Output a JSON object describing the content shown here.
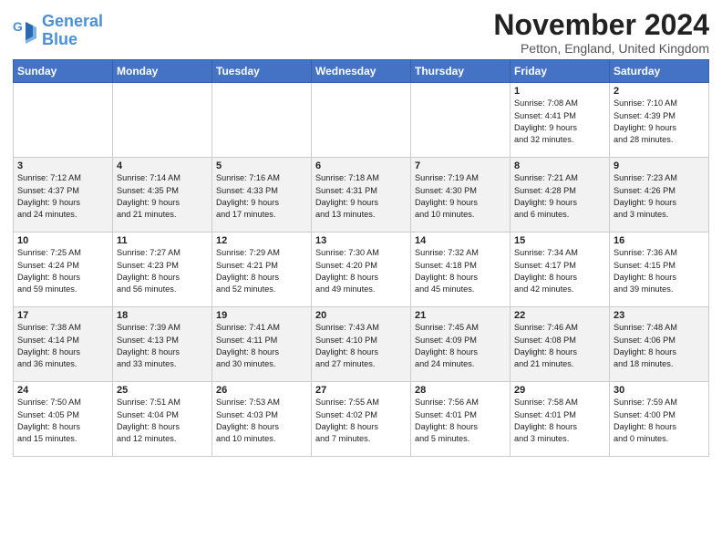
{
  "logo": {
    "line1": "General",
    "line2": "Blue"
  },
  "title": "November 2024",
  "location": "Petton, England, United Kingdom",
  "headers": [
    "Sunday",
    "Monday",
    "Tuesday",
    "Wednesday",
    "Thursday",
    "Friday",
    "Saturday"
  ],
  "weeks": [
    [
      {
        "num": "",
        "info": ""
      },
      {
        "num": "",
        "info": ""
      },
      {
        "num": "",
        "info": ""
      },
      {
        "num": "",
        "info": ""
      },
      {
        "num": "",
        "info": ""
      },
      {
        "num": "1",
        "info": "Sunrise: 7:08 AM\nSunset: 4:41 PM\nDaylight: 9 hours\nand 32 minutes."
      },
      {
        "num": "2",
        "info": "Sunrise: 7:10 AM\nSunset: 4:39 PM\nDaylight: 9 hours\nand 28 minutes."
      }
    ],
    [
      {
        "num": "3",
        "info": "Sunrise: 7:12 AM\nSunset: 4:37 PM\nDaylight: 9 hours\nand 24 minutes."
      },
      {
        "num": "4",
        "info": "Sunrise: 7:14 AM\nSunset: 4:35 PM\nDaylight: 9 hours\nand 21 minutes."
      },
      {
        "num": "5",
        "info": "Sunrise: 7:16 AM\nSunset: 4:33 PM\nDaylight: 9 hours\nand 17 minutes."
      },
      {
        "num": "6",
        "info": "Sunrise: 7:18 AM\nSunset: 4:31 PM\nDaylight: 9 hours\nand 13 minutes."
      },
      {
        "num": "7",
        "info": "Sunrise: 7:19 AM\nSunset: 4:30 PM\nDaylight: 9 hours\nand 10 minutes."
      },
      {
        "num": "8",
        "info": "Sunrise: 7:21 AM\nSunset: 4:28 PM\nDaylight: 9 hours\nand 6 minutes."
      },
      {
        "num": "9",
        "info": "Sunrise: 7:23 AM\nSunset: 4:26 PM\nDaylight: 9 hours\nand 3 minutes."
      }
    ],
    [
      {
        "num": "10",
        "info": "Sunrise: 7:25 AM\nSunset: 4:24 PM\nDaylight: 8 hours\nand 59 minutes."
      },
      {
        "num": "11",
        "info": "Sunrise: 7:27 AM\nSunset: 4:23 PM\nDaylight: 8 hours\nand 56 minutes."
      },
      {
        "num": "12",
        "info": "Sunrise: 7:29 AM\nSunset: 4:21 PM\nDaylight: 8 hours\nand 52 minutes."
      },
      {
        "num": "13",
        "info": "Sunrise: 7:30 AM\nSunset: 4:20 PM\nDaylight: 8 hours\nand 49 minutes."
      },
      {
        "num": "14",
        "info": "Sunrise: 7:32 AM\nSunset: 4:18 PM\nDaylight: 8 hours\nand 45 minutes."
      },
      {
        "num": "15",
        "info": "Sunrise: 7:34 AM\nSunset: 4:17 PM\nDaylight: 8 hours\nand 42 minutes."
      },
      {
        "num": "16",
        "info": "Sunrise: 7:36 AM\nSunset: 4:15 PM\nDaylight: 8 hours\nand 39 minutes."
      }
    ],
    [
      {
        "num": "17",
        "info": "Sunrise: 7:38 AM\nSunset: 4:14 PM\nDaylight: 8 hours\nand 36 minutes."
      },
      {
        "num": "18",
        "info": "Sunrise: 7:39 AM\nSunset: 4:13 PM\nDaylight: 8 hours\nand 33 minutes."
      },
      {
        "num": "19",
        "info": "Sunrise: 7:41 AM\nSunset: 4:11 PM\nDaylight: 8 hours\nand 30 minutes."
      },
      {
        "num": "20",
        "info": "Sunrise: 7:43 AM\nSunset: 4:10 PM\nDaylight: 8 hours\nand 27 minutes."
      },
      {
        "num": "21",
        "info": "Sunrise: 7:45 AM\nSunset: 4:09 PM\nDaylight: 8 hours\nand 24 minutes."
      },
      {
        "num": "22",
        "info": "Sunrise: 7:46 AM\nSunset: 4:08 PM\nDaylight: 8 hours\nand 21 minutes."
      },
      {
        "num": "23",
        "info": "Sunrise: 7:48 AM\nSunset: 4:06 PM\nDaylight: 8 hours\nand 18 minutes."
      }
    ],
    [
      {
        "num": "24",
        "info": "Sunrise: 7:50 AM\nSunset: 4:05 PM\nDaylight: 8 hours\nand 15 minutes."
      },
      {
        "num": "25",
        "info": "Sunrise: 7:51 AM\nSunset: 4:04 PM\nDaylight: 8 hours\nand 12 minutes."
      },
      {
        "num": "26",
        "info": "Sunrise: 7:53 AM\nSunset: 4:03 PM\nDaylight: 8 hours\nand 10 minutes."
      },
      {
        "num": "27",
        "info": "Sunrise: 7:55 AM\nSunset: 4:02 PM\nDaylight: 8 hours\nand 7 minutes."
      },
      {
        "num": "28",
        "info": "Sunrise: 7:56 AM\nSunset: 4:01 PM\nDaylight: 8 hours\nand 5 minutes."
      },
      {
        "num": "29",
        "info": "Sunrise: 7:58 AM\nSunset: 4:01 PM\nDaylight: 8 hours\nand 3 minutes."
      },
      {
        "num": "30",
        "info": "Sunrise: 7:59 AM\nSunset: 4:00 PM\nDaylight: 8 hours\nand 0 minutes."
      }
    ]
  ]
}
